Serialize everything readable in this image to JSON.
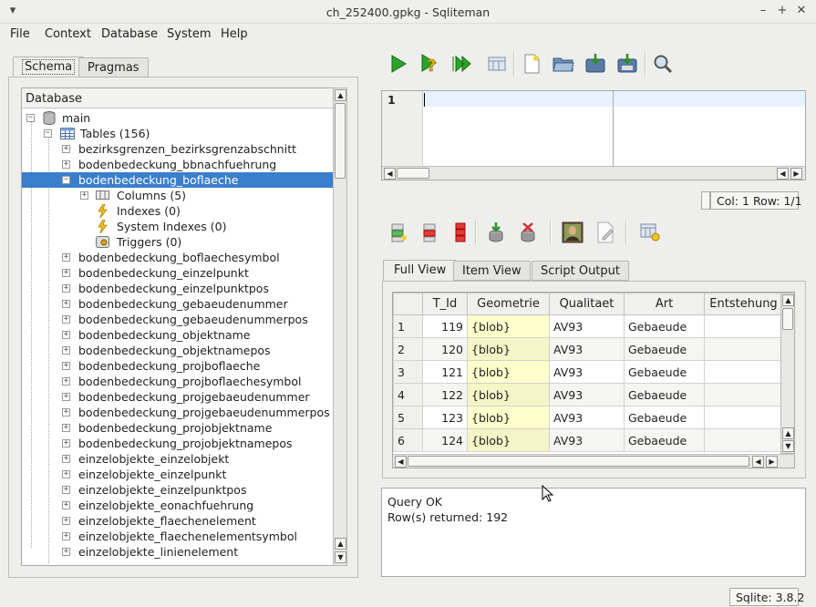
{
  "window": {
    "title": "ch_252400.gpkg - Sqliteman"
  },
  "menu": [
    "File",
    "Context",
    "Database",
    "System",
    "Help"
  ],
  "left_tabs": [
    "Schema",
    "Pragmas"
  ],
  "tree": {
    "header": "Database",
    "root": "main",
    "tables": "Tables (156)",
    "rows": [
      "bezirksgrenzen_bezirksgrenzabschnitt",
      "bodenbedeckung_bbnachfuehrung",
      "bodenbedeckung_boflaeche"
    ],
    "children": [
      "Columns (5)",
      "Indexes (0)",
      "System Indexes (0)",
      "Triggers (0)"
    ],
    "more": [
      "bodenbedeckung_boflaechesymbol",
      "bodenbedeckung_einzelpunkt",
      "bodenbedeckung_einzelpunktpos",
      "bodenbedeckung_gebaeudenummer",
      "bodenbedeckung_gebaeudenummerpos",
      "bodenbedeckung_objektname",
      "bodenbedeckung_objektnamepos",
      "bodenbedeckung_projboflaeche",
      "bodenbedeckung_projboflaechesymbol",
      "bodenbedeckung_projgebaeudenummer",
      "bodenbedeckung_projgebaeudenummerpos",
      "bodenbedeckung_projobjektname",
      "bodenbedeckung_projobjektnamepos",
      "einzelobjekte_einzelobjekt",
      "einzelobjekte_einzelpunkt",
      "einzelobjekte_einzelpunktpos",
      "einzelobjekte_eonachfuehrung",
      "einzelobjekte_flaechenelement",
      "einzelobjekte_flaechenelementsymbol",
      "einzelobjekte_linienelement"
    ]
  },
  "editor": {
    "line_number": "1"
  },
  "cursor_status": "Col: 1 Row: 1/1",
  "result_tabs": [
    "Full View",
    "Item View",
    "Script Output"
  ],
  "table": {
    "columns": [
      "T_Id",
      "Geometrie",
      "Qualitaet",
      "Art",
      "Entstehung"
    ],
    "rows": [
      [
        "1",
        "119",
        "{blob}",
        "AV93",
        "Gebaeude",
        ""
      ],
      [
        "2",
        "120",
        "{blob}",
        "AV93",
        "Gebaeude",
        ""
      ],
      [
        "3",
        "121",
        "{blob}",
        "AV93",
        "Gebaeude",
        ""
      ],
      [
        "4",
        "122",
        "{blob}",
        "AV93",
        "Gebaeude",
        ""
      ],
      [
        "5",
        "123",
        "{blob}",
        "AV93",
        "Gebaeude",
        ""
      ],
      [
        "6",
        "124",
        "{blob}",
        "AV93",
        "Gebaeude",
        ""
      ]
    ]
  },
  "messages": {
    "line1": "Query OK",
    "line2": "Row(s) returned: 192"
  },
  "sqlite_version": "Sqlite: 3.8.2",
  "colors": {
    "selection": "#3b7fcc",
    "blob_cell": "#ffffcc",
    "current_line": "#e8f2fe"
  }
}
